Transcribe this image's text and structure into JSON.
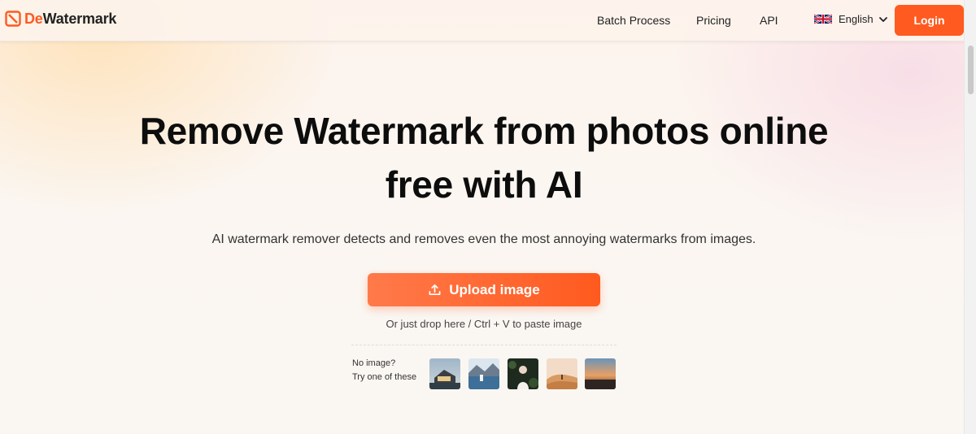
{
  "header": {
    "logo": {
      "prefix": "De",
      "rest": "Watermark",
      "icon": "logo-square-slash-icon",
      "brand_color": "#ff5a1f"
    },
    "nav": [
      "Batch Process",
      "Pricing",
      "API"
    ],
    "language": {
      "label": "English",
      "flag": "uk-flag-icon"
    },
    "login_label": "Login"
  },
  "hero": {
    "title_line1": "Remove Watermark from photos online",
    "title_line2": "free with AI",
    "subtitle": "AI watermark remover detects and removes even the most annoying watermarks from images.",
    "upload_label": "Upload image",
    "upload_icon": "upload-icon",
    "drop_hint": "Or just drop here / Ctrl + V to paste image",
    "samples": {
      "label_line1": "No image?",
      "label_line2": "Try one of these",
      "count": 5
    }
  },
  "colors": {
    "accent": "#ff5a1f",
    "accent_light": "#ff7a4a"
  }
}
